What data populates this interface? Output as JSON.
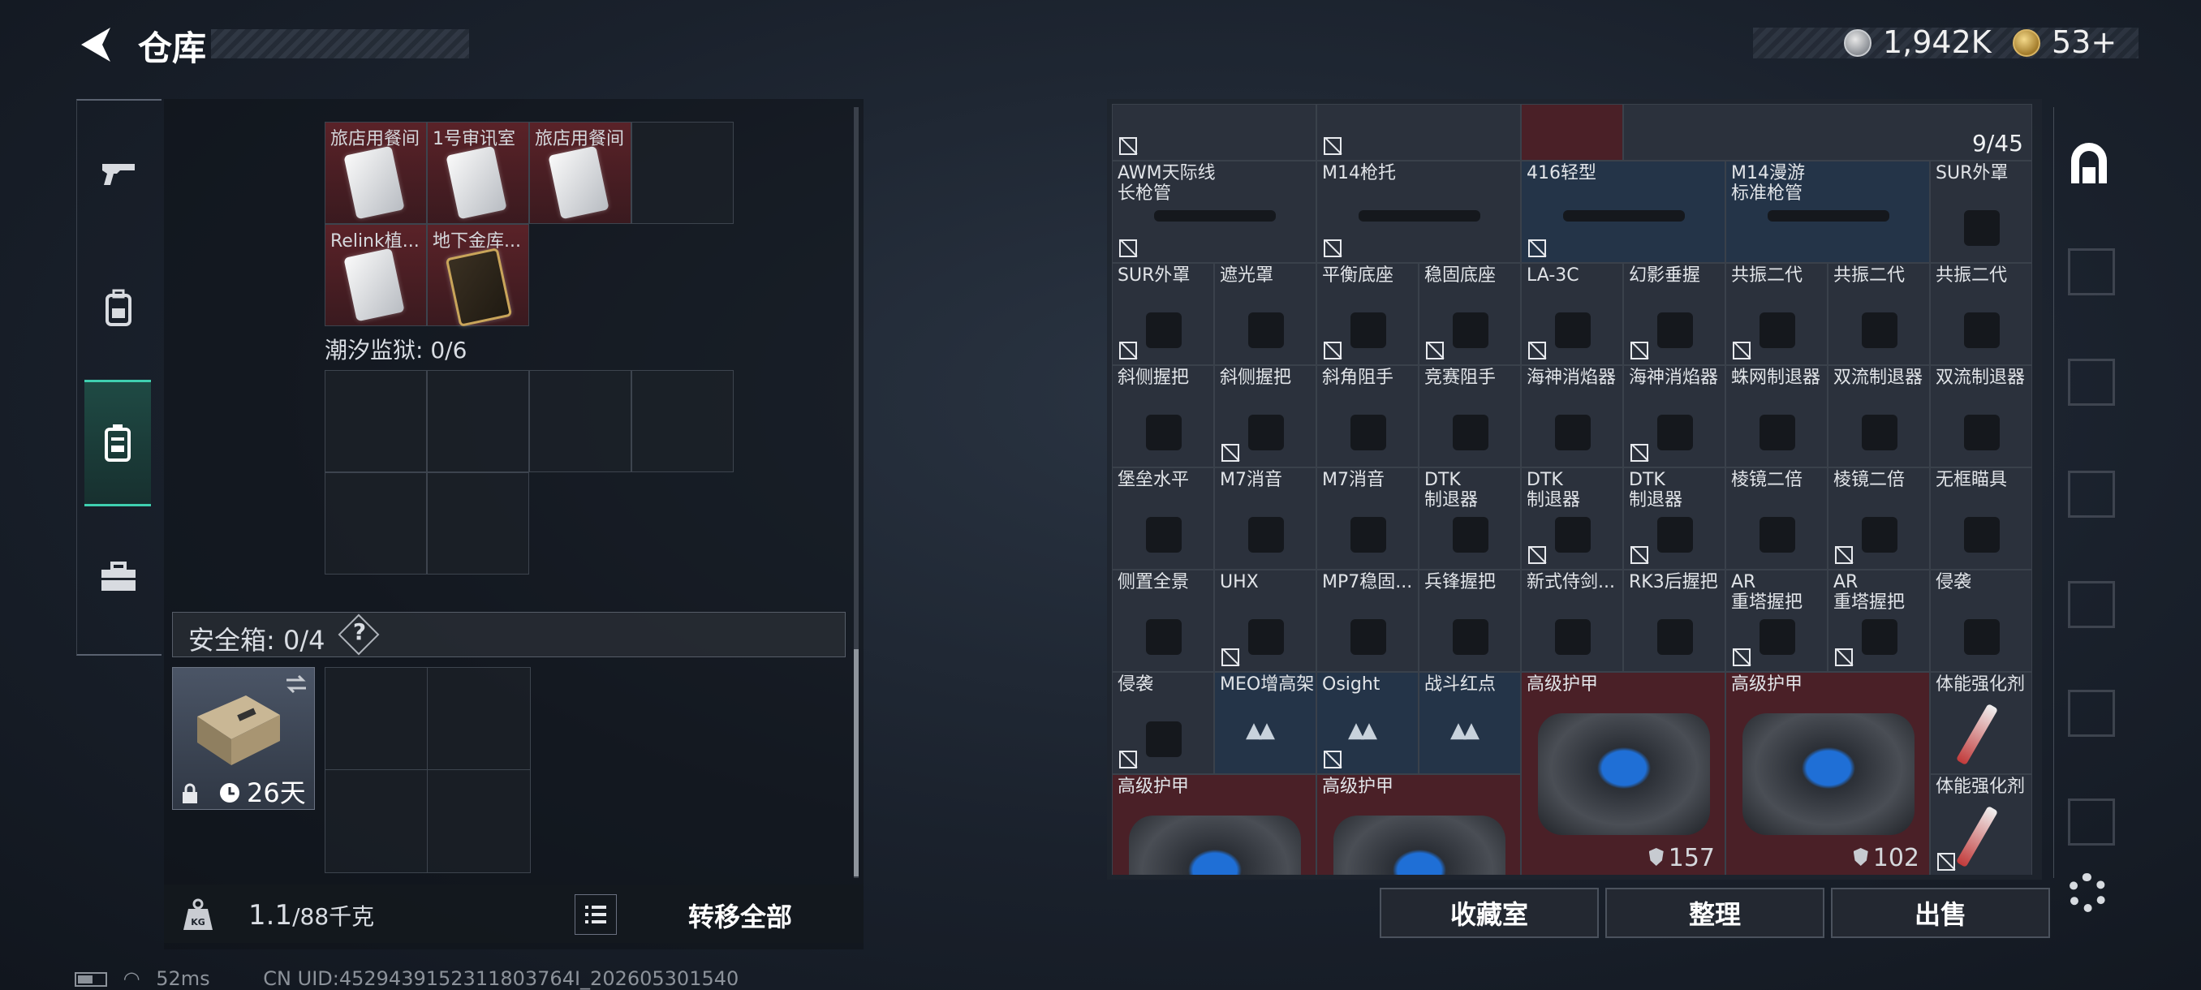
{
  "header": {
    "title": "仓库",
    "silver": "1,942K",
    "gold": "53+"
  },
  "left": {
    "top_cells": [
      {
        "label": "旅店用餐间",
        "variant": "red",
        "icon": "white-keycard"
      },
      {
        "label": "1号审讯室",
        "variant": "red",
        "icon": "white-keycard"
      },
      {
        "label": "旅店用餐间",
        "variant": "red",
        "icon": "white-keycard"
      },
      {
        "label": "Relink植...",
        "variant": "red",
        "icon": "white-keycard"
      },
      {
        "label": "地下金库...",
        "variant": "red",
        "icon": "gold-keycard"
      }
    ],
    "prison_label": "潮汐监狱: 0/6",
    "safe_label": "安全箱: 0/4",
    "help": "?",
    "safebox_days": "26天",
    "weight_value": "1.1",
    "weight_max": "/88千克",
    "transfer_all": "转移全部"
  },
  "right": {
    "count": "9/45",
    "rows": [
      [
        {
          "l": "AWM天际线\n长枪管",
          "c": "",
          "x": 1,
          "w": 2
        },
        {
          "l": "M14枪托",
          "c": "",
          "x": 1,
          "w": 2
        },
        {
          "l": "416轻型",
          "c": "blue",
          "x": 1,
          "w": 2
        },
        {
          "l": "M14漫游\n标准枪管",
          "c": "blue",
          "x": 0,
          "w": 2
        },
        {
          "l": "SUR外罩",
          "c": "",
          "x": 0,
          "w": 1
        }
      ],
      [
        {
          "l": "SUR外罩",
          "c": "",
          "x": 1
        },
        {
          "l": "遮光罩",
          "c": "",
          "x": 0
        },
        {
          "l": "平衡底座",
          "c": "",
          "x": 1
        },
        {
          "l": "稳固底座",
          "c": "",
          "x": 1
        },
        {
          "l": "LA-3C",
          "c": "",
          "x": 1
        },
        {
          "l": "幻影垂握",
          "c": "",
          "x": 1
        },
        {
          "l": "共振二代",
          "c": "",
          "x": 1
        },
        {
          "l": "共振二代",
          "c": "",
          "x": 0
        },
        {
          "l": "共振二代",
          "c": "",
          "x": 0
        }
      ],
      [
        {
          "l": "斜侧握把",
          "c": "",
          "x": 0
        },
        {
          "l": "斜侧握把",
          "c": "",
          "x": 1
        },
        {
          "l": "斜角阻手",
          "c": "",
          "x": 0
        },
        {
          "l": "竞赛阻手",
          "c": "",
          "x": 0
        },
        {
          "l": "海神消焰器",
          "c": "",
          "x": 0
        },
        {
          "l": "海神消焰器",
          "c": "",
          "x": 1
        },
        {
          "l": "蛛网制退器",
          "c": "",
          "x": 0
        },
        {
          "l": "双流制退器",
          "c": "",
          "x": 0
        },
        {
          "l": "双流制退器",
          "c": "",
          "x": 0
        }
      ],
      [
        {
          "l": "堡垒水平",
          "c": "",
          "x": 0
        },
        {
          "l": "M7消音",
          "c": "",
          "x": 0
        },
        {
          "l": "M7消音",
          "c": "",
          "x": 0
        },
        {
          "l": "DTK\n制退器",
          "c": "",
          "x": 0
        },
        {
          "l": "DTK\n制退器",
          "c": "",
          "x": 1
        },
        {
          "l": "DTK\n制退器",
          "c": "",
          "x": 1
        },
        {
          "l": "棱镜二倍",
          "c": "",
          "x": 0
        },
        {
          "l": "棱镜二倍",
          "c": "",
          "x": 1
        },
        {
          "l": "无框瞄具",
          "c": "",
          "x": 0
        }
      ],
      [
        {
          "l": "侧置全景",
          "c": "",
          "x": 0
        },
        {
          "l": "UHX",
          "c": "",
          "x": 1
        },
        {
          "l": "MP7稳固...",
          "c": "",
          "x": 0
        },
        {
          "l": "兵锋握把",
          "c": "",
          "x": 0
        },
        {
          "l": "新式侍剑...",
          "c": "",
          "x": 0
        },
        {
          "l": "RK3后握把",
          "c": "",
          "x": 0
        },
        {
          "l": "AR\n重塔握把",
          "c": "",
          "x": 1
        },
        {
          "l": "AR\n重塔握把",
          "c": "",
          "x": 1
        },
        {
          "l": "侵袭",
          "c": "",
          "x": 0
        }
      ],
      [
        {
          "l": "侵袭",
          "c": "",
          "x": 1
        },
        {
          "l": "MEO增高架",
          "c": "blue",
          "x": 0
        },
        {
          "l": "Osight",
          "c": "blue",
          "x": 1
        },
        {
          "l": "战斗红点",
          "c": "blue",
          "x": 0
        }
      ]
    ],
    "armor": [
      {
        "label": "高级护甲",
        "durability": "157"
      },
      {
        "label": "高级护甲",
        "durability": "102"
      },
      {
        "label": "高级护甲",
        "durability": ""
      },
      {
        "label": "高级护甲",
        "durability": ""
      }
    ],
    "potions": [
      {
        "label": "体能强化剂"
      },
      {
        "label": "体能强化剂"
      }
    ],
    "buttons": {
      "collection": "收藏室",
      "sort": "整理",
      "sell": "出售"
    }
  },
  "status": {
    "ping": "52ms",
    "uid": "CN UID:4529439152311803764I_202605301540"
  }
}
